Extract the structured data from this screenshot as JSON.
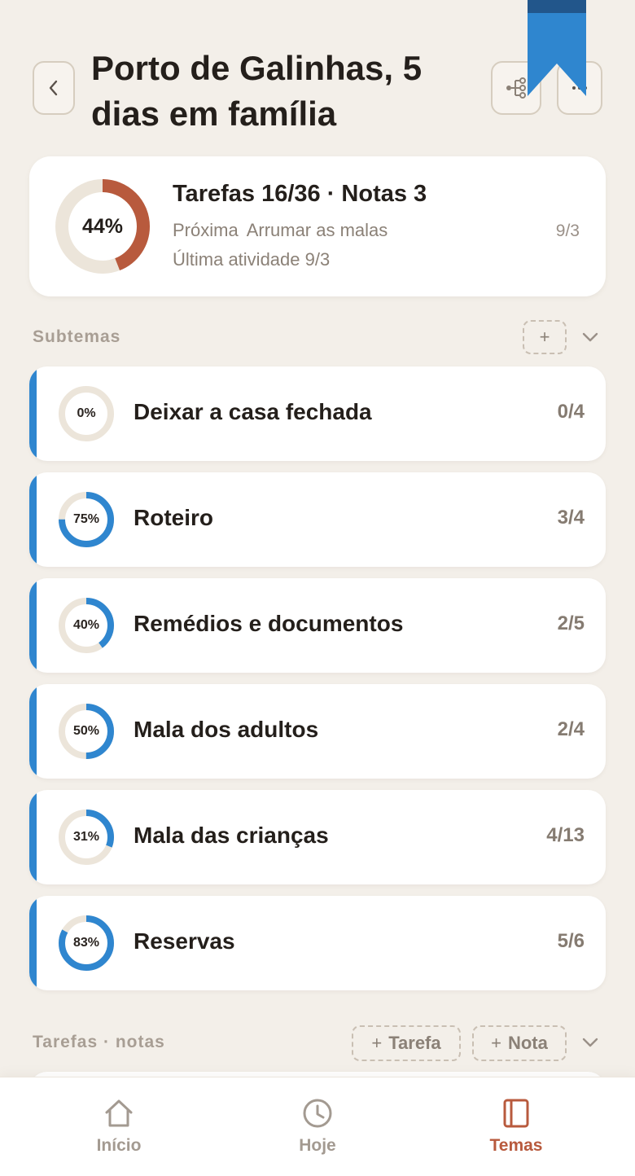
{
  "header": {
    "title": "Porto de Galinhas, 5 dias em família",
    "back_icon": "chevron-left-icon",
    "tree_icon": "tree-structure-icon",
    "more_icon": "more-horizontal-icon",
    "bookmark_color": "#2f86cf"
  },
  "summary": {
    "percent_label": "44%",
    "progress": 0.44,
    "headline": "Tarefas 16/36 · Notas 3",
    "next_label": "Próxima",
    "next_task": "Arrumar as malas",
    "next_date": "9/3",
    "last_activity": "Última atividade 9/3",
    "ring_color": "#b85a3d"
  },
  "subtopics_section": {
    "label": "Subtemas",
    "add_label": "+"
  },
  "subtopics": [
    {
      "title": "Deixar a casa fechada",
      "percent_label": "0%",
      "progress": 0.0,
      "count": "0/4"
    },
    {
      "title": "Roteiro",
      "percent_label": "75%",
      "progress": 0.75,
      "count": "3/4"
    },
    {
      "title": "Remédios e documentos",
      "percent_label": "40%",
      "progress": 0.4,
      "count": "2/5"
    },
    {
      "title": "Mala dos adultos",
      "percent_label": "50%",
      "progress": 0.5,
      "count": "2/4"
    },
    {
      "title": "Mala das crianças",
      "percent_label": "31%",
      "progress": 0.31,
      "count": "4/13"
    },
    {
      "title": "Reservas",
      "percent_label": "83%",
      "progress": 0.83,
      "count": "5/6"
    }
  ],
  "tasks_section": {
    "label": "Tarefas · notas",
    "add_task_plus": "+",
    "add_task_label": "Tarefa",
    "add_note_plus": "+",
    "add_note_label": "Nota"
  },
  "nav": {
    "items": [
      {
        "label": "Início",
        "icon": "home-icon",
        "active": false
      },
      {
        "label": "Hoje",
        "icon": "clock-icon",
        "active": false
      },
      {
        "label": "Temas",
        "icon": "notebook-icon",
        "active": true
      }
    ]
  },
  "colors": {
    "accent_blue": "#2f86cf",
    "accent_terracotta": "#b85a3d",
    "ring_track": "#ece5da",
    "background": "#f3efe9"
  }
}
